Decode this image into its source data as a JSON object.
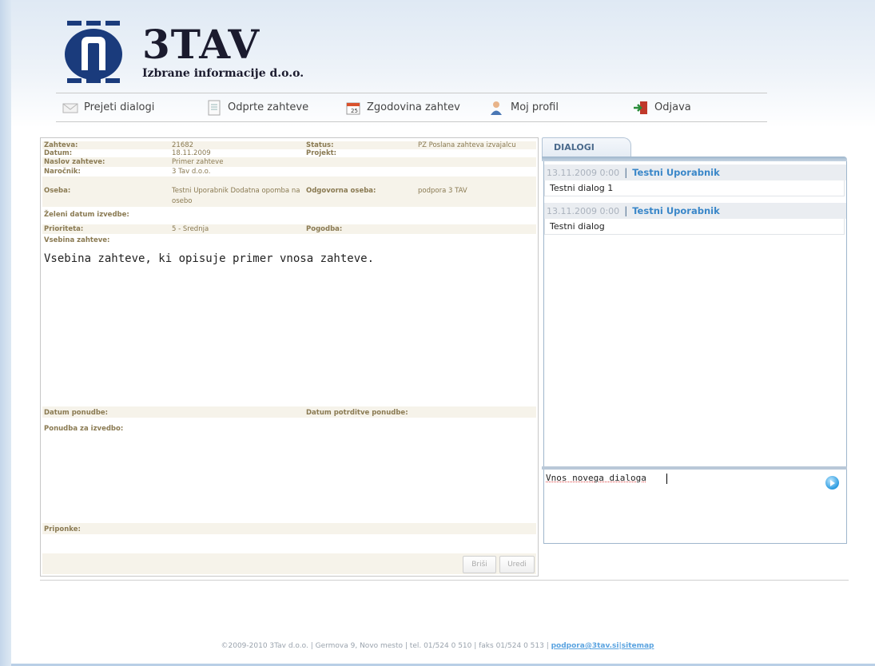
{
  "logo": {
    "name": "3TAV",
    "subtitle": "Izbrane informacije d.o.o."
  },
  "nav": [
    {
      "label": "Prejeti dialogi",
      "icon": "envelope-icon"
    },
    {
      "label": "Odprte zahteve",
      "icon": "document-icon"
    },
    {
      "label": "Zgodovina zahtev",
      "icon": "calendar-icon"
    },
    {
      "label": "Moj profil",
      "icon": "user-icon"
    },
    {
      "label": "Odjava",
      "icon": "logout-icon"
    }
  ],
  "request": {
    "zahteva_label": "Zahteva:",
    "zahteva": "21682",
    "status_label": "Status:",
    "status": "PZ Poslana zahteva izvajalcu",
    "datum_label": "Datum:",
    "datum": "18.11.2009",
    "projekt_label": "Projekt:",
    "naslov_label": "Naslov zahteve:",
    "naslov": "Primer zahteve",
    "narocnik_label": "Naročnik:",
    "narocnik": "3 Tav d.o.o.",
    "oseba_label": "Oseba:",
    "oseba_line1": "Testni Uporabnik Dodatna opomba na",
    "oseba_line2": "osebo",
    "odgovorna_label": "Odgovorna oseba:",
    "odgovorna": "podpora 3 TAV",
    "zeleni_label": "Želeni datum izvedbe:",
    "prioriteta_label": "Prioriteta:",
    "prioriteta": "5 - Srednja",
    "pogodba_label": "Pogodba:",
    "vsebina_label": "Vsebina zahteve:",
    "vsebina": "Vsebina zahteve, ki opisuje primer vnosa zahteve.",
    "datum_ponudbe_label": "Datum ponudbe:",
    "datum_potrditve_label": "Datum potrditve ponudbe:",
    "ponudba_label": "Ponudba za izvedbo:",
    "priponke_label": "Priponke:",
    "delete_label": "Briši",
    "edit_label": "Uredi"
  },
  "dialogs": {
    "tab_label": "DIALOGI",
    "items": [
      {
        "date": "13.11.2009 0:00",
        "user": "Testni Uporabnik",
        "text": "Testni dialog 1"
      },
      {
        "date": "13.11.2009 0:00",
        "user": "Testni Uporabnik",
        "text": "Testni dialog"
      }
    ],
    "input_value": "Vnos novega dialoga"
  },
  "footer": {
    "text": "©2009-2010 3Tav d.o.o. | Germova 9, Novo mesto | tel. 01/524 0 510 | faks 01/524 0 513 | ",
    "email": "podpora@3tav.si",
    "sep": "|",
    "sitemap": "sitemap"
  }
}
